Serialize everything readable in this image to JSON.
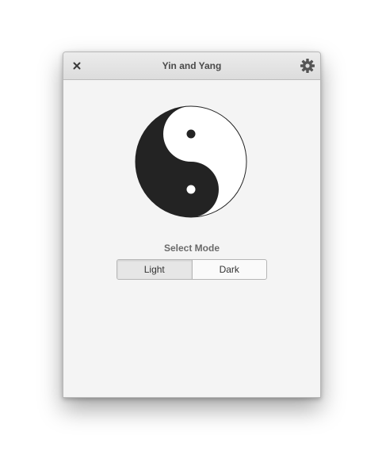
{
  "window": {
    "title": "Yin and Yang"
  },
  "titlebar": {
    "close_icon": "close-icon",
    "settings_icon": "gear-icon"
  },
  "symbol": {
    "icon": "yin-yang-icon",
    "dark_color": "#232323",
    "light_color": "#ffffff"
  },
  "mode_selector": {
    "label": "Select Mode",
    "options": [
      {
        "label": "Light",
        "selected": true
      },
      {
        "label": "Dark",
        "selected": false
      }
    ]
  },
  "colors": {
    "window_background": "#f4f4f4",
    "titlebar_background": "#dcdcdc",
    "title_text": "#4a4a4a",
    "border": "#b6b6b6"
  }
}
